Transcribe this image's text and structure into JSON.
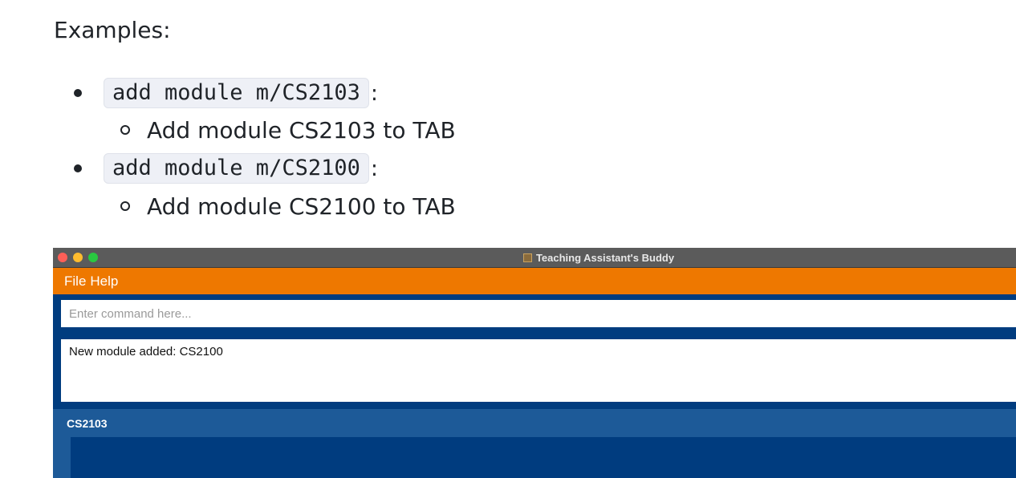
{
  "doc": {
    "heading": "Examples:",
    "examples": [
      {
        "command": "add module m/CS2103",
        "colon": ":",
        "description": "Add module CS2103 to TAB"
      },
      {
        "command": "add module m/CS2100",
        "colon": ":",
        "description": "Add module CS2100 to TAB"
      }
    ]
  },
  "app": {
    "window_title": "Teaching Assistant's Buddy",
    "menu": {
      "file": "File",
      "help": "Help"
    },
    "command_box": {
      "placeholder": "Enter command here...",
      "value": ""
    },
    "result_text": "New module added: CS2100",
    "module_list": [
      {
        "name": "CS2103"
      }
    ],
    "colors": {
      "menubar": "#ee7800",
      "titlebar": "#5b5b5b",
      "background": "#003c7f",
      "module_header": "#1d5a98"
    }
  }
}
